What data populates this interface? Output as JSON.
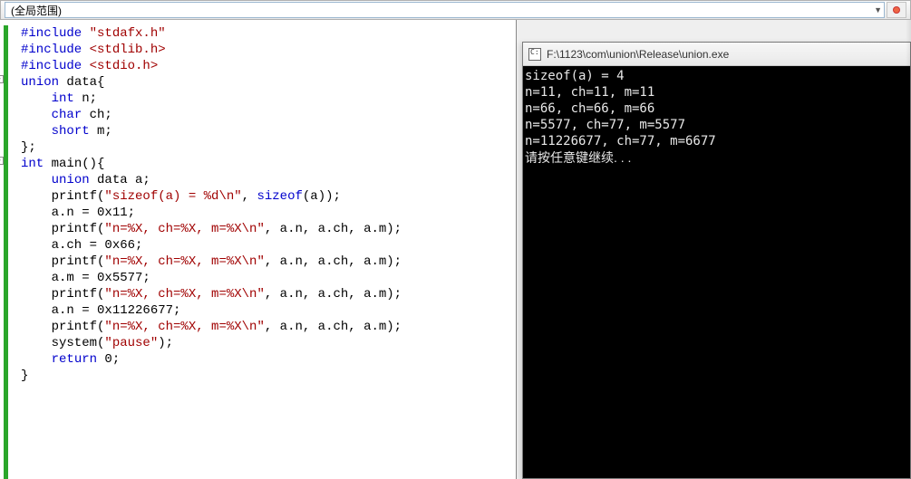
{
  "topbar": {
    "scope_label": "(全局范围)"
  },
  "code": {
    "l1_pp": "#include ",
    "l1_h": "\"stdafx.h\"",
    "l2_pp": "#include ",
    "l2_h": "<stdlib.h>",
    "l3_pp": "#include ",
    "l3_h": "<stdio.h>",
    "l4_kw": "union",
    "l4_rest": " data{",
    "l5_kw": "int",
    "l5_rest": " n;",
    "l6_kw": "char",
    "l6_rest": " ch;",
    "l7_kw": "short",
    "l7_rest": " m;",
    "l8": "};",
    "l9_kw": "int",
    "l9_rest": " main(){",
    "l10_kw": "union",
    "l10_rest": " data a;",
    "l11_a": "    printf(",
    "l11_s": "\"sizeof(a) = %d\\n\"",
    "l11_b": ", ",
    "l11_kw": "sizeof",
    "l11_c": "(a));",
    "l12": "    a.n = 0x11;",
    "l13_a": "    printf(",
    "l13_s": "\"n=%X, ch=%X, m=%X\\n\"",
    "l13_b": ", a.n, a.ch, a.m);",
    "l14": "    a.ch = 0x66;",
    "l15_a": "    printf(",
    "l15_s": "\"n=%X, ch=%X, m=%X\\n\"",
    "l15_b": ", a.n, a.ch, a.m);",
    "l16": "    a.m = 0x5577;",
    "l17_a": "    printf(",
    "l17_s": "\"n=%X, ch=%X, m=%X\\n\"",
    "l17_b": ", a.n, a.ch, a.m);",
    "l18": "    a.n = 0x11226677;",
    "l19_a": "    printf(",
    "l19_s": "\"n=%X, ch=%X, m=%X\\n\"",
    "l19_b": ", a.n, a.ch, a.m);",
    "l20_a": "    system(",
    "l20_s": "\"pause\"",
    "l20_b": ");",
    "l21_kw": "return",
    "l21_rest": " 0;",
    "l22": "}"
  },
  "console": {
    "title": "F:\\1123\\com\\union\\Release\\union.exe",
    "out1": "sizeof(a) = 4",
    "out2": "n=11, ch=11, m=11",
    "out3": "n=66, ch=66, m=66",
    "out4": "n=5577, ch=77, m=5577",
    "out5": "n=11226677, ch=77, m=6677",
    "prompt": "请按任意键继续. . ."
  }
}
